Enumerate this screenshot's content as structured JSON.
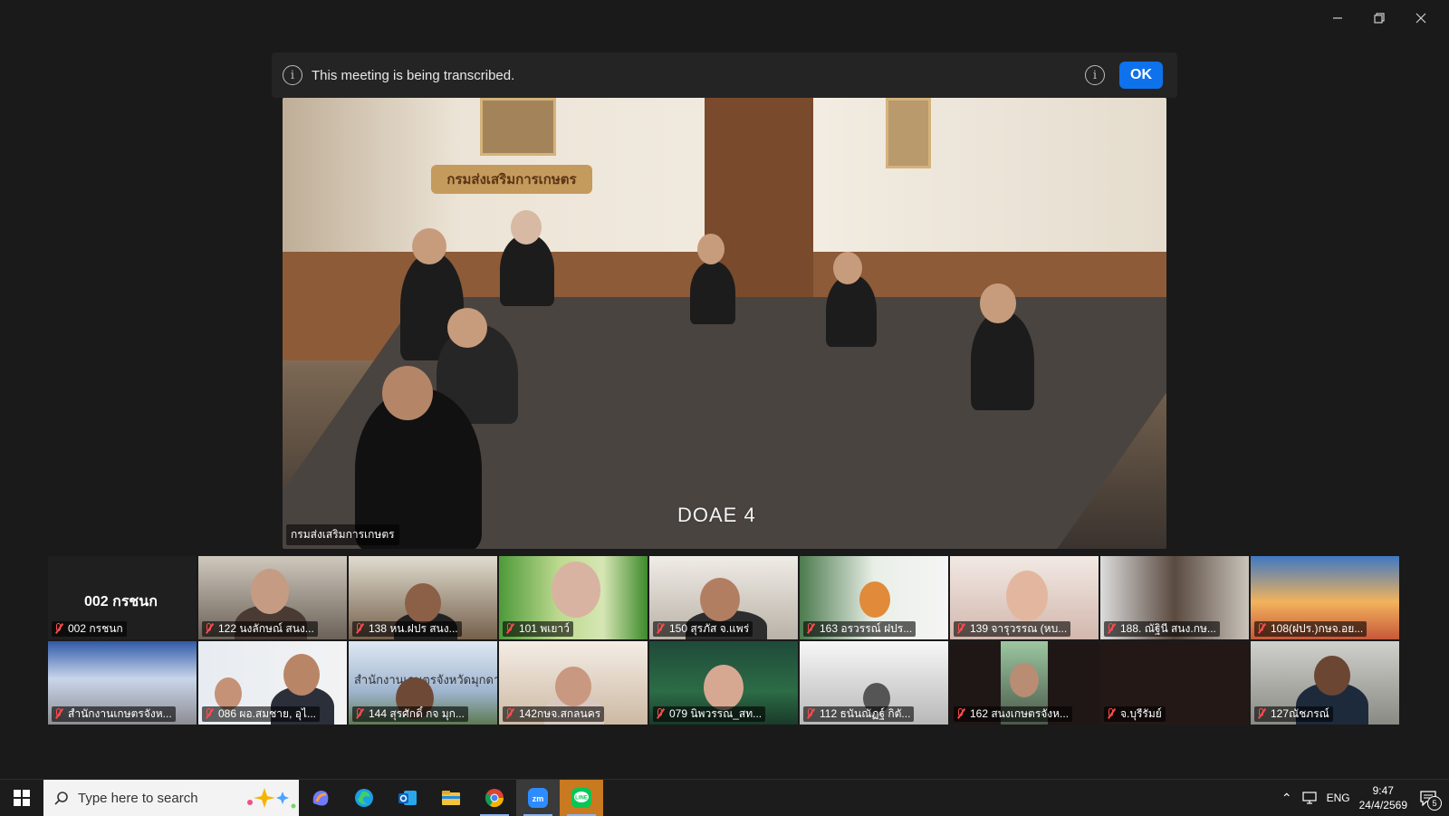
{
  "banner": {
    "message": "This meeting is being transcribed.",
    "ok_label": "OK"
  },
  "main_video": {
    "sign_text": "กรมส่งเสริมการเกษตร",
    "participant_label": "กรมส่งเสริมการเกษตร",
    "room_label": "DOAE 4"
  },
  "gallery": {
    "self_display_name": "002 กรชนก",
    "row1": [
      {
        "name": "002 กรชนก"
      },
      {
        "name": "122 นงลักษณ์ สนง..."
      },
      {
        "name": "138  หน.ฝปร  สนง..."
      },
      {
        "name": "101 พเยาว์"
      },
      {
        "name": "150 สุรภัส จ.แพร่"
      },
      {
        "name": "163 อรวรรณ์  ฝปร..."
      },
      {
        "name": "139 จารุวรรณ (หบ..."
      },
      {
        "name": "188. ณัฐินี สนง.กษ..."
      },
      {
        "name": "108(ฝปร.)กษจ.อย..."
      }
    ],
    "row2": [
      {
        "name": "สำนักงานเกษตรจังห..."
      },
      {
        "name": "086 ผอ.สมชาย, อุไ..."
      },
      {
        "name": "144 สุรศักดิ์ กจ มุก..."
      },
      {
        "name": "142กษจ.สกลนคร"
      },
      {
        "name": "079 นิพวรรณ_สท..."
      },
      {
        "name": "112 ธนันณัฏฐ์ กิตั..."
      },
      {
        "name": "162 สนงเกษตรจังห..."
      },
      {
        "name": "จ.บุรีรัมย์"
      },
      {
        "name": "127ณัชภรณ์"
      }
    ],
    "tile_overlay_texts": {
      "office_sign": "สำนักงานเกษตรจังหวัดมุกดาหาร"
    }
  },
  "taskbar": {
    "search_placeholder": "Type here to search",
    "language": "ENG",
    "time": "9:47",
    "date": "24/4/2569",
    "notification_count": "5",
    "apps": [
      "copilot-icon",
      "edge-icon",
      "outlook-icon",
      "file-explorer-icon",
      "chrome-icon",
      "zoom-icon",
      "line-icon"
    ]
  },
  "colors": {
    "accent_blue": "#0e72ed",
    "mute_red": "#ff4b4b",
    "background": "#1a1a1a"
  }
}
